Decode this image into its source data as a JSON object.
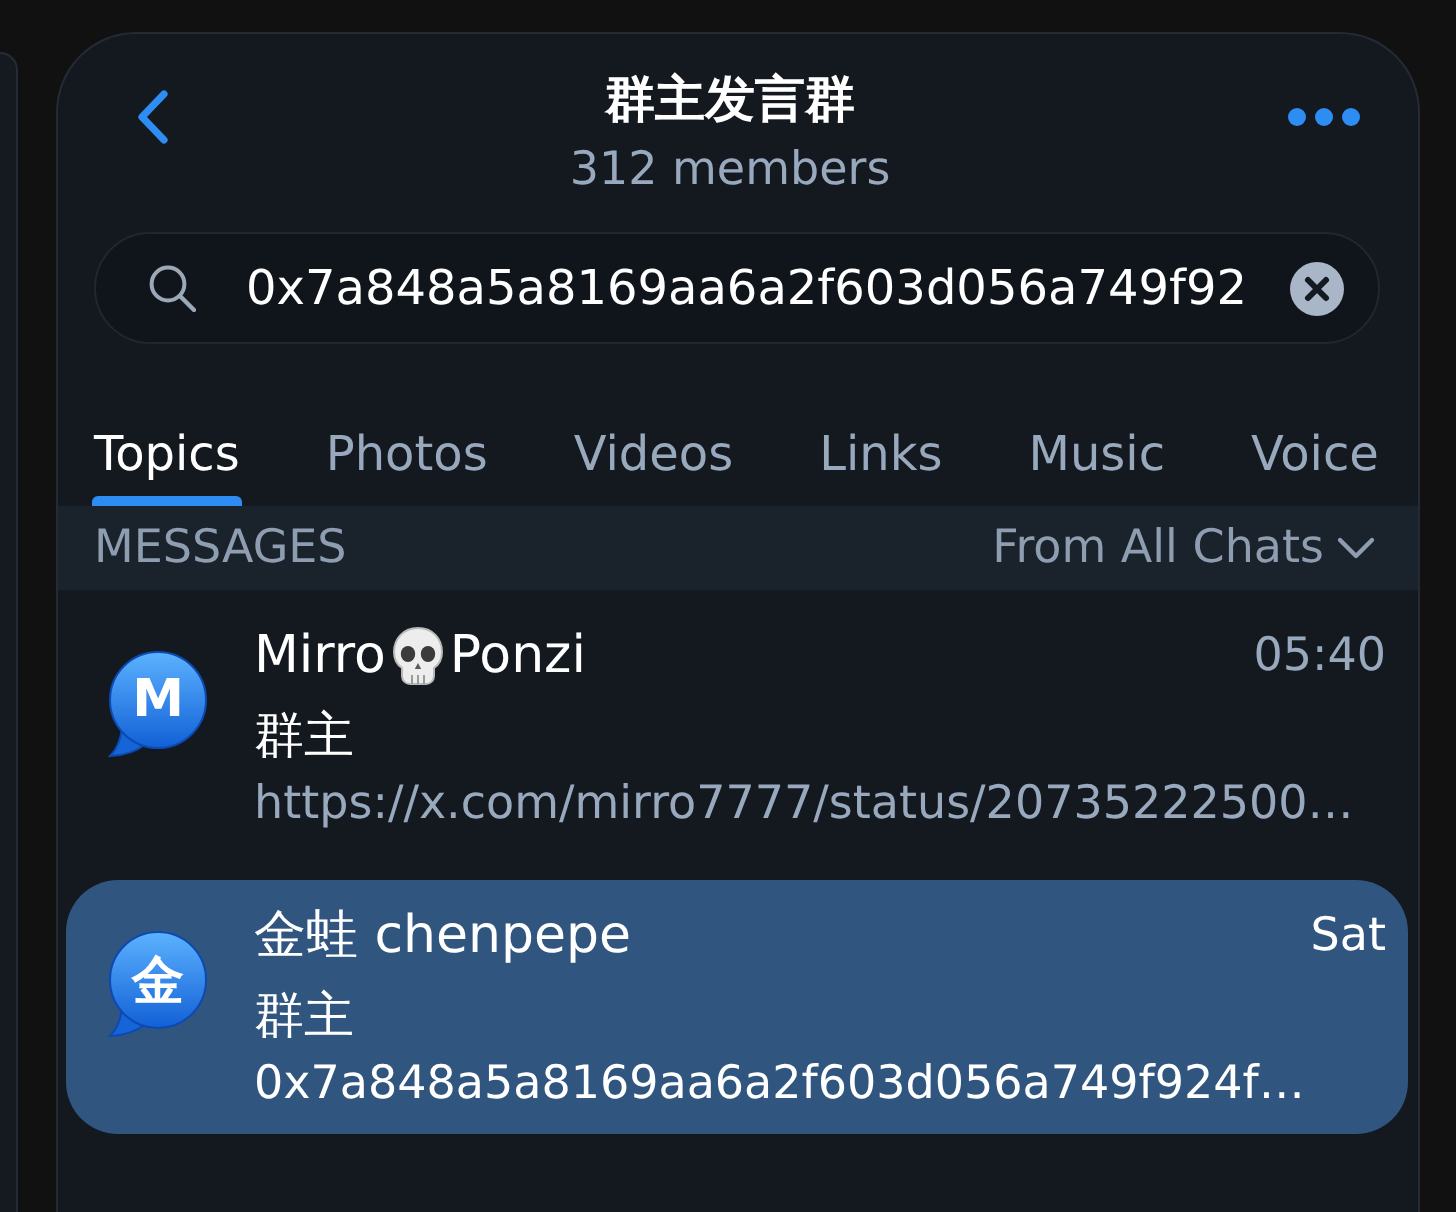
{
  "header": {
    "title": "群主发言群",
    "subtitle": "312 members"
  },
  "search": {
    "value": "0x7a848a5a8169aa6a2f603d056a749f92"
  },
  "tabs": [
    {
      "label": "Topics",
      "selected": true
    },
    {
      "label": "Photos",
      "selected": false
    },
    {
      "label": "Videos",
      "selected": false
    },
    {
      "label": "Links",
      "selected": false
    },
    {
      "label": "Music",
      "selected": false
    },
    {
      "label": "Voice",
      "selected": false
    }
  ],
  "section": {
    "title": "MESSAGES",
    "filter": "From All Chats"
  },
  "results": [
    {
      "avatar": "M",
      "name": [
        {
          "kind": "text",
          "text": "Mirro"
        },
        {
          "kind": "emoji"
        },
        {
          "kind": "text",
          "text": "Ponzi"
        }
      ],
      "time": "05:40",
      "subtitle": "群主",
      "preview": "https://x.com/mirro7777/status/20735222500…",
      "selected": false
    },
    {
      "avatar": "金",
      "name": [
        {
          "kind": "text",
          "text": "金蛙 chenpepe"
        }
      ],
      "time": "Sat",
      "subtitle": "群主",
      "preview": "0x7a848a5a8169aa6a2f603d056a749f924f…",
      "selected": true
    }
  ]
}
